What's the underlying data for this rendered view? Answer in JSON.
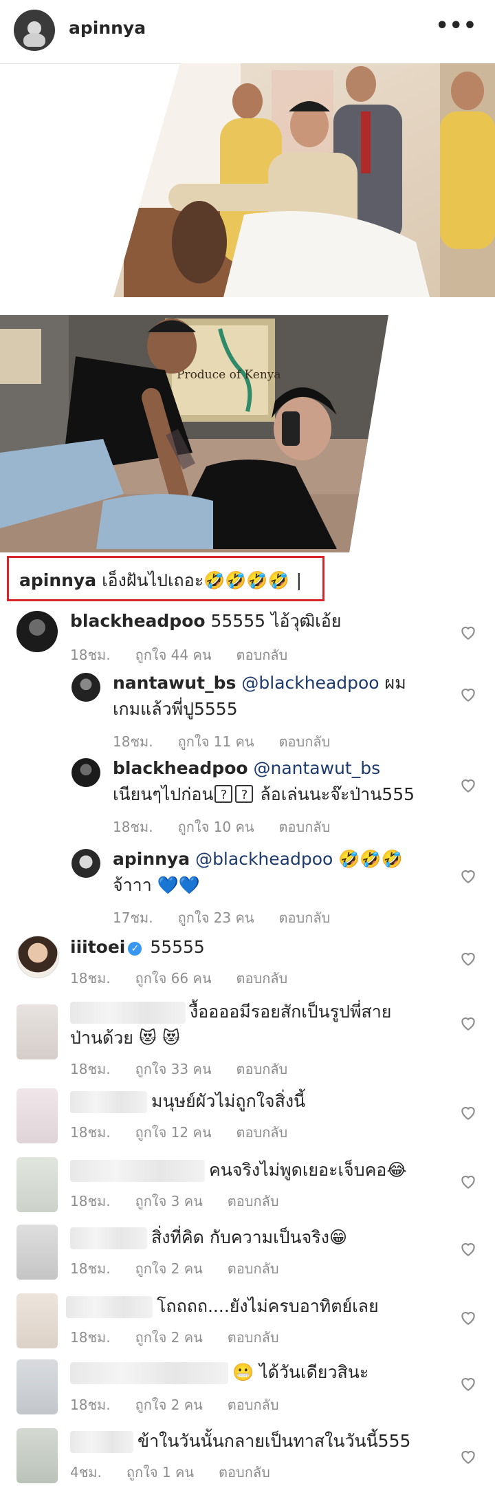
{
  "post": {
    "username": "apinnya",
    "more_icon": "•••",
    "caption": {
      "username": "apinnya",
      "text": "เอ็งฝันไปเถอะ",
      "emojis": "🤣🤣🤣🤣",
      "cursor": "|"
    },
    "photo2_sign": "Produce of Kenya"
  },
  "comments": [
    {
      "user": "blackheadpoo",
      "text": "55555 ไอ้วุฒิเอ้ย",
      "time": "18ชม.",
      "likes": "ถูกใจ 44 คน",
      "reply": "ตอบกลับ"
    },
    {
      "user": "nantawut_bs",
      "mention": "@blackheadpoo",
      "text": " ผม",
      "text2": "เกมแล้วพี่ปู5555",
      "time": "18ชม.",
      "likes": "ถูกใจ 11 คน",
      "reply": "ตอบกลับ"
    },
    {
      "user": "blackheadpoo",
      "mention": "@nantawut_bs",
      "text": "เนียนๆไปก่อน",
      "box1": "?",
      "box2": "?",
      "text2": " ล้อเล่นนะจ๊ะป่าน555",
      "time": "18ชม.",
      "likes": "ถูกใจ 10 คน",
      "reply": "ตอบกลับ"
    },
    {
      "user": "apinnya",
      "mention": "@blackheadpoo",
      "emojis": "🤣🤣🤣",
      "text": "จ้าาา",
      "hearts": "💙💙",
      "time": "17ชม.",
      "likes": "ถูกใจ 23 คน",
      "reply": "ตอบกลับ"
    },
    {
      "user": "iiitoei",
      "verified": "✓",
      "text": "55555",
      "time": "18ชม.",
      "likes": "ถูกใจ 66 คน",
      "reply": "ตอบกลับ"
    },
    {
      "text": "งื้ออออมีรอยสักเป็นรูปพี่สาย",
      "text2": "ป่านด้วย",
      "emojis": "😻 😻",
      "time": "18ชม.",
      "likes": "ถูกใจ 33 คน",
      "reply": "ตอบกลับ"
    },
    {
      "text": "มนุษย์ผัวไม่ถูกใจสิ่งนี้",
      "time": "18ชม.",
      "likes": "ถูกใจ 12 คน",
      "reply": "ตอบกลับ"
    },
    {
      "text": "คนจริงไม่พูดเยอะเจ็บคอ",
      "emojis": "😂",
      "time": "18ชม.",
      "likes": "ถูกใจ 3 คน",
      "reply": "ตอบกลับ"
    },
    {
      "text": "สิ่งที่คิด กับความเป็นจริง",
      "emojis": "😁",
      "time": "18ชม.",
      "likes": "ถูกใจ 2 คน",
      "reply": "ตอบกลับ"
    },
    {
      "text": "โถถถถ....ยังไม่ครบอาทิตย์เลย",
      "time": "18ชม.",
      "likes": "ถูกใจ 2 คน",
      "reply": "ตอบกลับ"
    },
    {
      "emojis": "😬",
      "text": " ได้วันเดียวสินะ",
      "time": "18ชม.",
      "likes": "ถูกใจ 2 คน",
      "reply": "ตอบกลับ"
    },
    {
      "text": "ข้าในวันนั้นกลายเป็นทาสในวันนี้555",
      "time": "4ชม.",
      "likes": "ถูกใจ 1 คน",
      "reply": "ตอบกลับ"
    }
  ]
}
